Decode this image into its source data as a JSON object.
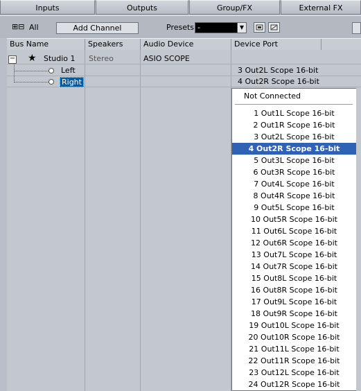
{
  "tabs": [
    "Inputs",
    "Outputs",
    "Group/FX",
    "External FX"
  ],
  "toolbar": {
    "expand_all_label": "All",
    "add_channel_label": "Add Channel",
    "presets_label": "Presets",
    "presets_value": "-"
  },
  "columns": [
    "Bus Name",
    "Speakers",
    "Audio Device",
    "Device Port"
  ],
  "bus": {
    "name": "Studio 1",
    "speakers": "Stereo",
    "audio_device": "ASIO SCOPE",
    "channels": [
      {
        "name": "Left",
        "port": "3 Out2L Scope 16-bit"
      },
      {
        "name": "Right",
        "port": "4 Out2R Scope 16-bit"
      }
    ]
  },
  "port_menu": {
    "not_connected": "Not Connected",
    "selected_index": 3,
    "items": [
      "1 Out1L Scope 16-bit",
      "2 Out1R Scope 16-bit",
      "3 Out2L Scope 16-bit",
      "4 Out2R Scope 16-bit",
      "5 Out3L Scope 16-bit",
      "6 Out3R Scope 16-bit",
      "7 Out4L Scope 16-bit",
      "8 Out4R Scope 16-bit",
      "9 Out5L Scope 16-bit",
      "10 Out5R Scope 16-bit",
      "11 Out6L Scope 16-bit",
      "12 Out6R Scope 16-bit",
      "13 Out7L Scope 16-bit",
      "14 Out7R Scope 16-bit",
      "15 Out8L Scope 16-bit",
      "16 Out8R Scope 16-bit",
      "17 Out9L Scope 16-bit",
      "18 Out9R Scope 16-bit",
      "19 Out10L Scope 16-bit",
      "20 Out10R Scope 16-bit",
      "21 Out11L Scope 16-bit",
      "22 Out11R Scope 16-bit",
      "23 Out12L Scope 16-bit",
      "24 Out12R Scope 16-bit"
    ]
  },
  "icons": {
    "expand": "expand-all-icon",
    "star": "star-icon"
  }
}
